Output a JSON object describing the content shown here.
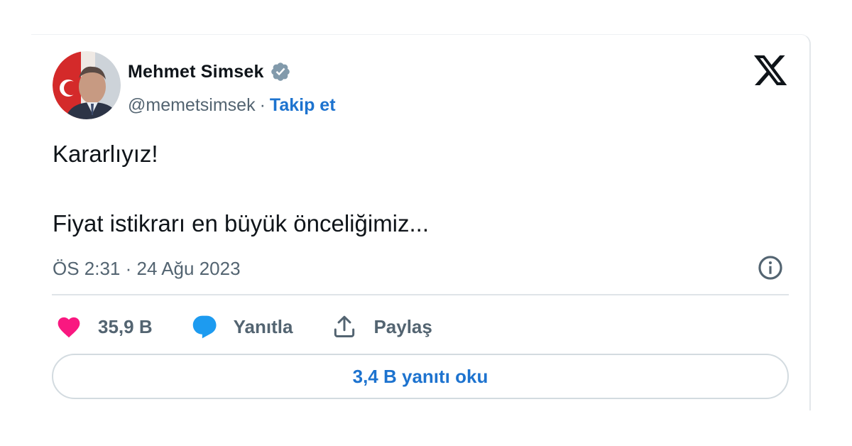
{
  "author": {
    "display_name": "Mehmet Simsek",
    "handle": "@memetsimsek",
    "separator": "·",
    "follow_label": "Takip et",
    "verified_badge_icon": "verified-badge-icon"
  },
  "brand": {
    "logo_icon": "x-logo-icon"
  },
  "tweet": {
    "line1": "Kararlıyız!",
    "line2": "Fiyat istikrarı en büyük önceliğimiz..."
  },
  "meta": {
    "timestamp": "ÖS 2:31 · 24 Ağu 2023",
    "info_icon": "info-icon"
  },
  "actions": {
    "like_count": "35,9 B",
    "reply_label": "Yanıtla",
    "share_label": "Paylaş"
  },
  "replies_button": {
    "label": "3,4 B yanıtı oku"
  },
  "colors": {
    "text_primary": "#0f1419",
    "text_secondary": "#536471",
    "link_blue": "#1d73cf",
    "heart_pink": "#f91880",
    "reply_blue": "#1d9bf0",
    "verified_gray": "#829aab"
  }
}
